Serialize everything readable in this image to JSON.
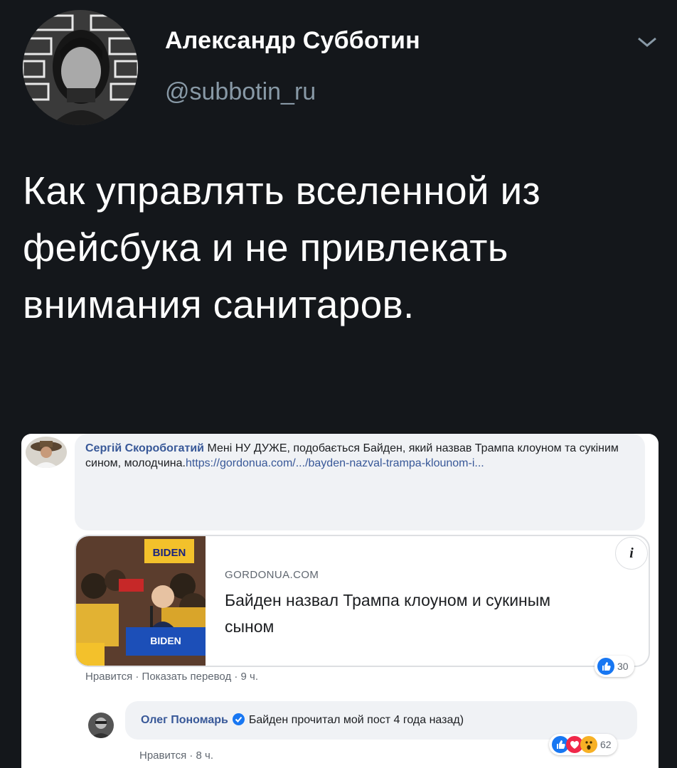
{
  "tweet": {
    "author_name": "Александр Субботин",
    "author_handle": "@subbotin_ru",
    "text": "Как управлять вселенной из фейсбука и не привлекать внимания санитаров."
  },
  "embedded": {
    "comment1": {
      "author": "Сергій Скоробогатий",
      "text": " Мені НУ ДУЖЕ, подобається Байден, який назвав Трампа клоуном та сукіним сином, молодчина.",
      "link": "https://gordonua.com/.../bayden-nazval-trampa-klounom-i..."
    },
    "link_card": {
      "domain": "GORDONUA.COM",
      "title": "Байден назвал Трампа клоуном и сукиным сыном",
      "image_sign_top": "BIDEN",
      "image_sign_bottom": "BIDEN"
    },
    "comment1_meta": {
      "like": "Нравится",
      "translate": "Показать перевод",
      "time": "9 ч.",
      "reactions_count": "30"
    },
    "comment2": {
      "author": "Олег Пономарь",
      "text": "Байден прочитал мой пост 4 года назад)"
    },
    "comment2_meta": {
      "like": "Нравится",
      "time": "8 ч.",
      "reactions_count": "62"
    },
    "colors": {
      "background": "#14171b",
      "fb_link_blue": "#385898",
      "like_blue": "#1877f2",
      "love_red": "#f02849",
      "wow_yellow": "#f7b125"
    },
    "icons": [
      "chevron-down-icon",
      "info-icon",
      "like-reaction-icon",
      "love-reaction-icon",
      "wow-reaction-icon",
      "verified-badge-icon"
    ]
  }
}
